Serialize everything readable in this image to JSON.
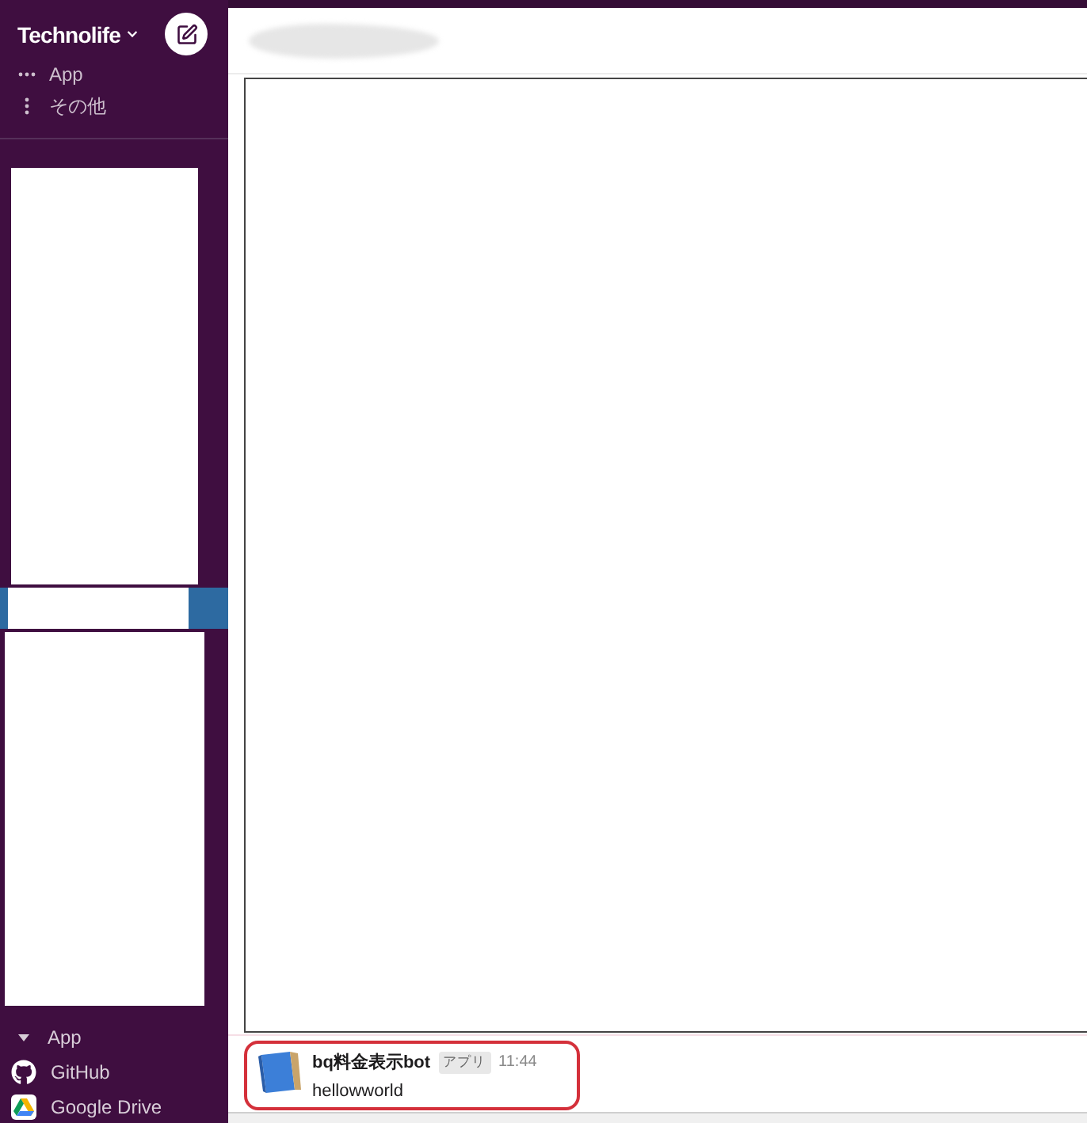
{
  "workspace": {
    "name": "Technolife"
  },
  "sidebar": {
    "top_items": [
      {
        "kind": "more",
        "label": "App"
      },
      {
        "kind": "overflow",
        "label": "その他"
      }
    ],
    "apps_section": {
      "label": "App",
      "expanded": true,
      "items": [
        {
          "kind": "github",
          "label": "GitHub"
        },
        {
          "kind": "drive",
          "label": "Google Drive"
        }
      ]
    }
  },
  "message": {
    "sender": "bq料金表示bot",
    "badge": "アプリ",
    "time": "11:44",
    "text": "hellowworld",
    "annotated": true
  }
}
